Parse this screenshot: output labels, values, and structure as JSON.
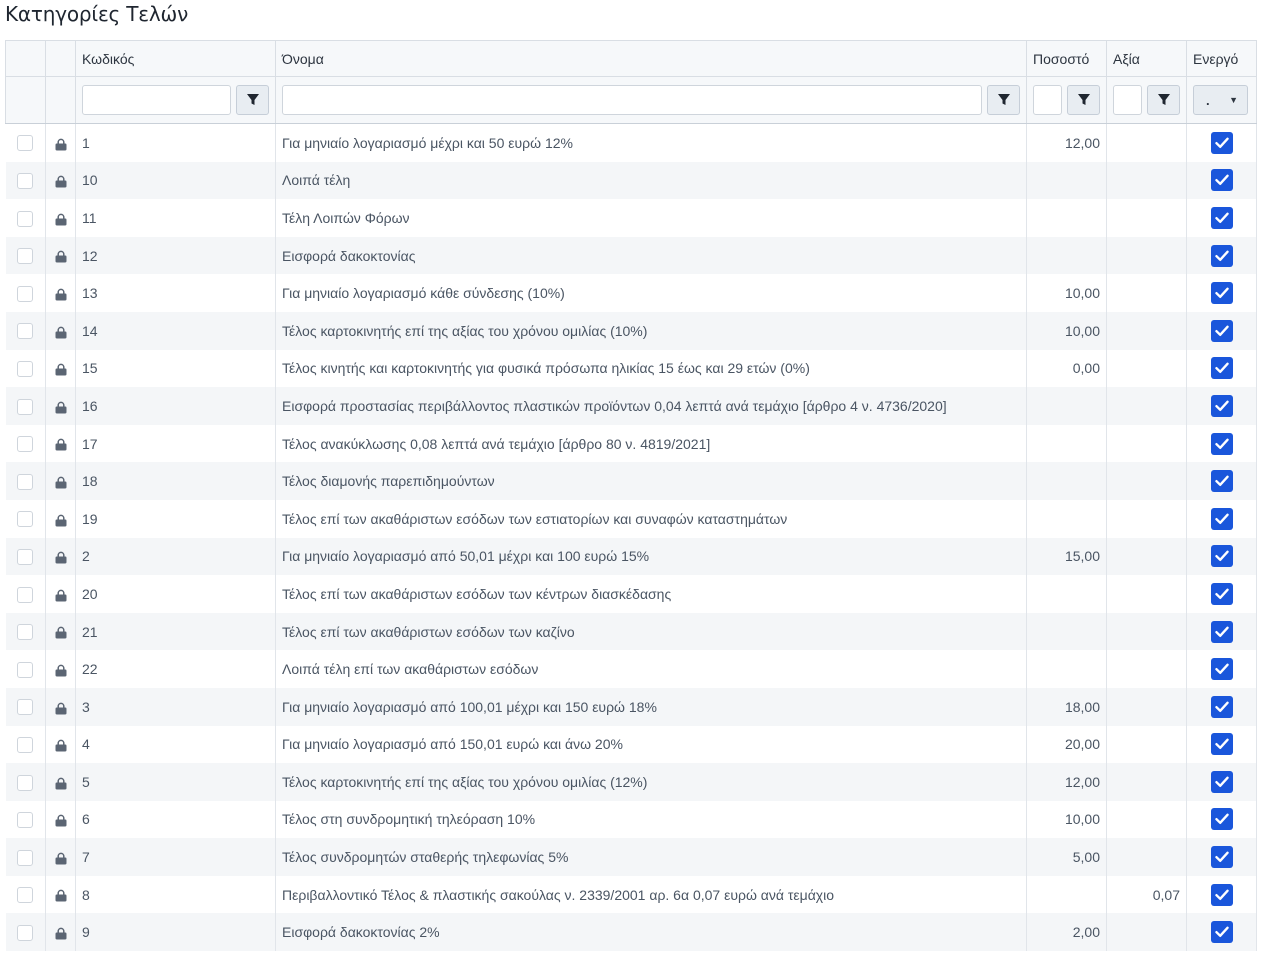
{
  "page": {
    "title": "Κατηγορίες Τελών"
  },
  "columns": {
    "code": "Κωδικός",
    "name": "Όνομα",
    "percent": "Ποσοστό",
    "value": "Αξία",
    "active": "Ενεργό"
  },
  "filters": {
    "code": "",
    "name": "",
    "percent": "",
    "value": "",
    "active_selected": "."
  },
  "icons": {
    "filter": "filter-funnel-icon",
    "lock": "lock-icon",
    "check": "check-icon"
  },
  "colors": {
    "accent": "#1a56db",
    "header_bg": "#f6f8fa",
    "alt_row": "#f4f6f8"
  },
  "rows": [
    {
      "code": "1",
      "name": "Για μηνιαίο λογαριασμό μέχρι και 50 ευρώ 12%",
      "percent": "12,00",
      "value": "",
      "active": true
    },
    {
      "code": "10",
      "name": "Λοιπά τέλη",
      "percent": "",
      "value": "",
      "active": true
    },
    {
      "code": "11",
      "name": "Τέλη Λοιπών Φόρων",
      "percent": "",
      "value": "",
      "active": true
    },
    {
      "code": "12",
      "name": "Εισφορά δακοκτονίας",
      "percent": "",
      "value": "",
      "active": true
    },
    {
      "code": "13",
      "name": "Για μηνιαίο λογαριασμό κάθε σύνδεσης (10%)",
      "percent": "10,00",
      "value": "",
      "active": true
    },
    {
      "code": "14",
      "name": "Τέλος καρτοκινητής επί της αξίας του χρόνου ομιλίας (10%)",
      "percent": "10,00",
      "value": "",
      "active": true
    },
    {
      "code": "15",
      "name": "Τέλος κινητής και καρτοκινητής για φυσικά πρόσωπα ηλικίας 15 έως και 29 ετών (0%)",
      "percent": "0,00",
      "value": "",
      "active": true
    },
    {
      "code": "16",
      "name": "Εισφορά προστασίας περιβάλλοντος πλαστικών προϊόντων 0,04 λεπτά ανά τεμάχιο [άρθρο 4 ν. 4736/2020]",
      "percent": "",
      "value": "",
      "active": true
    },
    {
      "code": "17",
      "name": "Τέλος ανακύκλωσης 0,08 λεπτά ανά τεμάχιο [άρθρο 80 ν. 4819/2021]",
      "percent": "",
      "value": "",
      "active": true
    },
    {
      "code": "18",
      "name": "Τέλος διαμονής παρεπιδημούντων",
      "percent": "",
      "value": "",
      "active": true
    },
    {
      "code": "19",
      "name": "Τέλος επί των ακαθάριστων εσόδων των εστιατορίων και συναφών καταστημάτων",
      "percent": "",
      "value": "",
      "active": true
    },
    {
      "code": "2",
      "name": "Για μηνιαίο λογαριασμό από 50,01 μέχρι και 100 ευρώ 15%",
      "percent": "15,00",
      "value": "",
      "active": true
    },
    {
      "code": "20",
      "name": "Τέλος επί των ακαθάριστων εσόδων των κέντρων διασκέδασης",
      "percent": "",
      "value": "",
      "active": true
    },
    {
      "code": "21",
      "name": "Τέλος επί των ακαθάριστων εσόδων των καζίνο",
      "percent": "",
      "value": "",
      "active": true
    },
    {
      "code": "22",
      "name": "Λοιπά τέλη επί των ακαθάριστων εσόδων",
      "percent": "",
      "value": "",
      "active": true
    },
    {
      "code": "3",
      "name": "Για μηνιαίο λογαριασμό από 100,01 μέχρι και 150 ευρώ 18%",
      "percent": "18,00",
      "value": "",
      "active": true
    },
    {
      "code": "4",
      "name": "Για μηνιαίο λογαριασμό από 150,01 ευρώ και άνω 20%",
      "percent": "20,00",
      "value": "",
      "active": true
    },
    {
      "code": "5",
      "name": "Τέλος καρτοκινητής επί της αξίας του χρόνου ομιλίας (12%)",
      "percent": "12,00",
      "value": "",
      "active": true
    },
    {
      "code": "6",
      "name": "Τέλος στη συνδρομητική τηλεόραση 10%",
      "percent": "10,00",
      "value": "",
      "active": true
    },
    {
      "code": "7",
      "name": "Τέλος συνδρομητών σταθερής τηλεφωνίας 5%",
      "percent": "5,00",
      "value": "",
      "active": true
    },
    {
      "code": "8",
      "name": "Περιβαλλοντικό Τέλος & πλαστικής σακούλας ν. 2339/2001 αρ. 6α 0,07 ευρώ ανά τεμάχιο",
      "percent": "",
      "value": "0,07",
      "active": true
    },
    {
      "code": "9",
      "name": "Εισφορά δακοκτονίας 2%",
      "percent": "2,00",
      "value": "",
      "active": true
    }
  ]
}
